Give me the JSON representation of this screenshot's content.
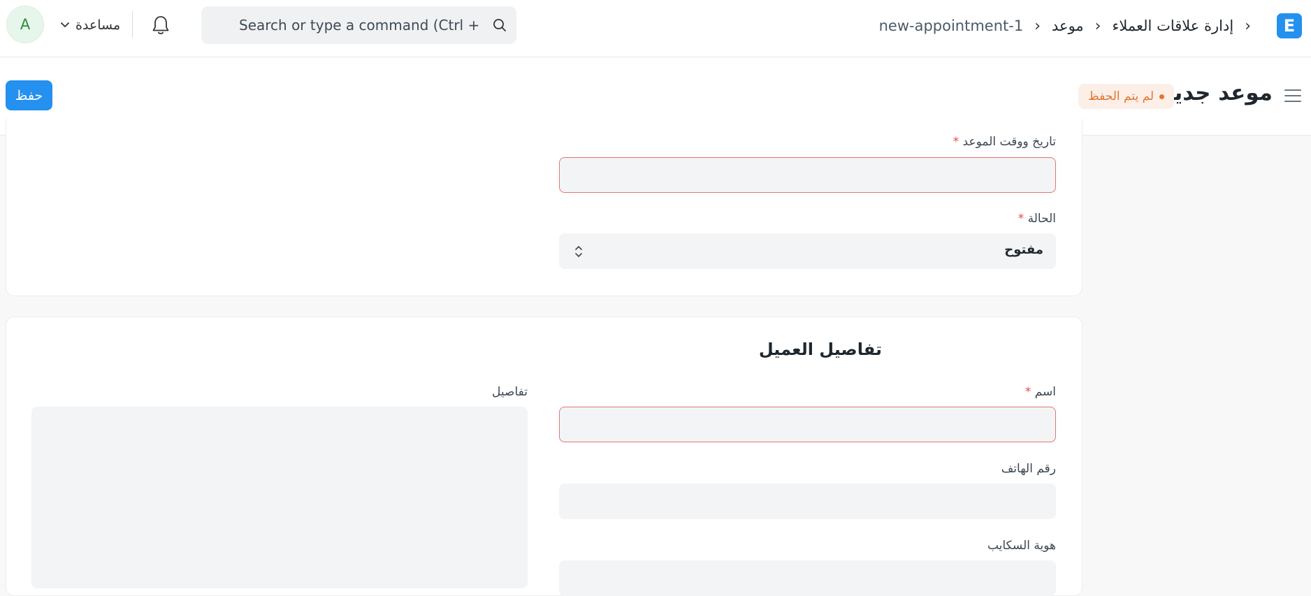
{
  "navbar": {
    "logo_letter": "E",
    "breadcrumbs": [
      "إدارة علاقات العملاء",
      "موعد",
      "new-appointment-1"
    ],
    "breadcrumb_separator": "›",
    "search_placeholder": "Search or type a command (Ctrl + G)",
    "help_label": "مساعدة",
    "avatar_initial": "A"
  },
  "page_header": {
    "title": "موعد جديد",
    "status": "لم يتم الحفظ",
    "save_label": "حفظ"
  },
  "appointment_section": {
    "datetime_label": "تاريخ ووقت الموعد",
    "datetime_value": "",
    "status_label": "الحالة",
    "status_value": "مفتوح",
    "required_mark": "*"
  },
  "customer_section": {
    "title": "تفاصيل العميل",
    "name_label": "اسم",
    "name_value": "",
    "phone_label": "رقم الهاتف",
    "phone_value": "",
    "skype_label": "هوية السكايب",
    "skype_value": "",
    "details_label": "تفاصيل",
    "details_value": "",
    "required_mark": "*"
  },
  "colors": {
    "primary": "#2490ef",
    "required": "#e24c4c",
    "unsaved": "#e0762f"
  }
}
